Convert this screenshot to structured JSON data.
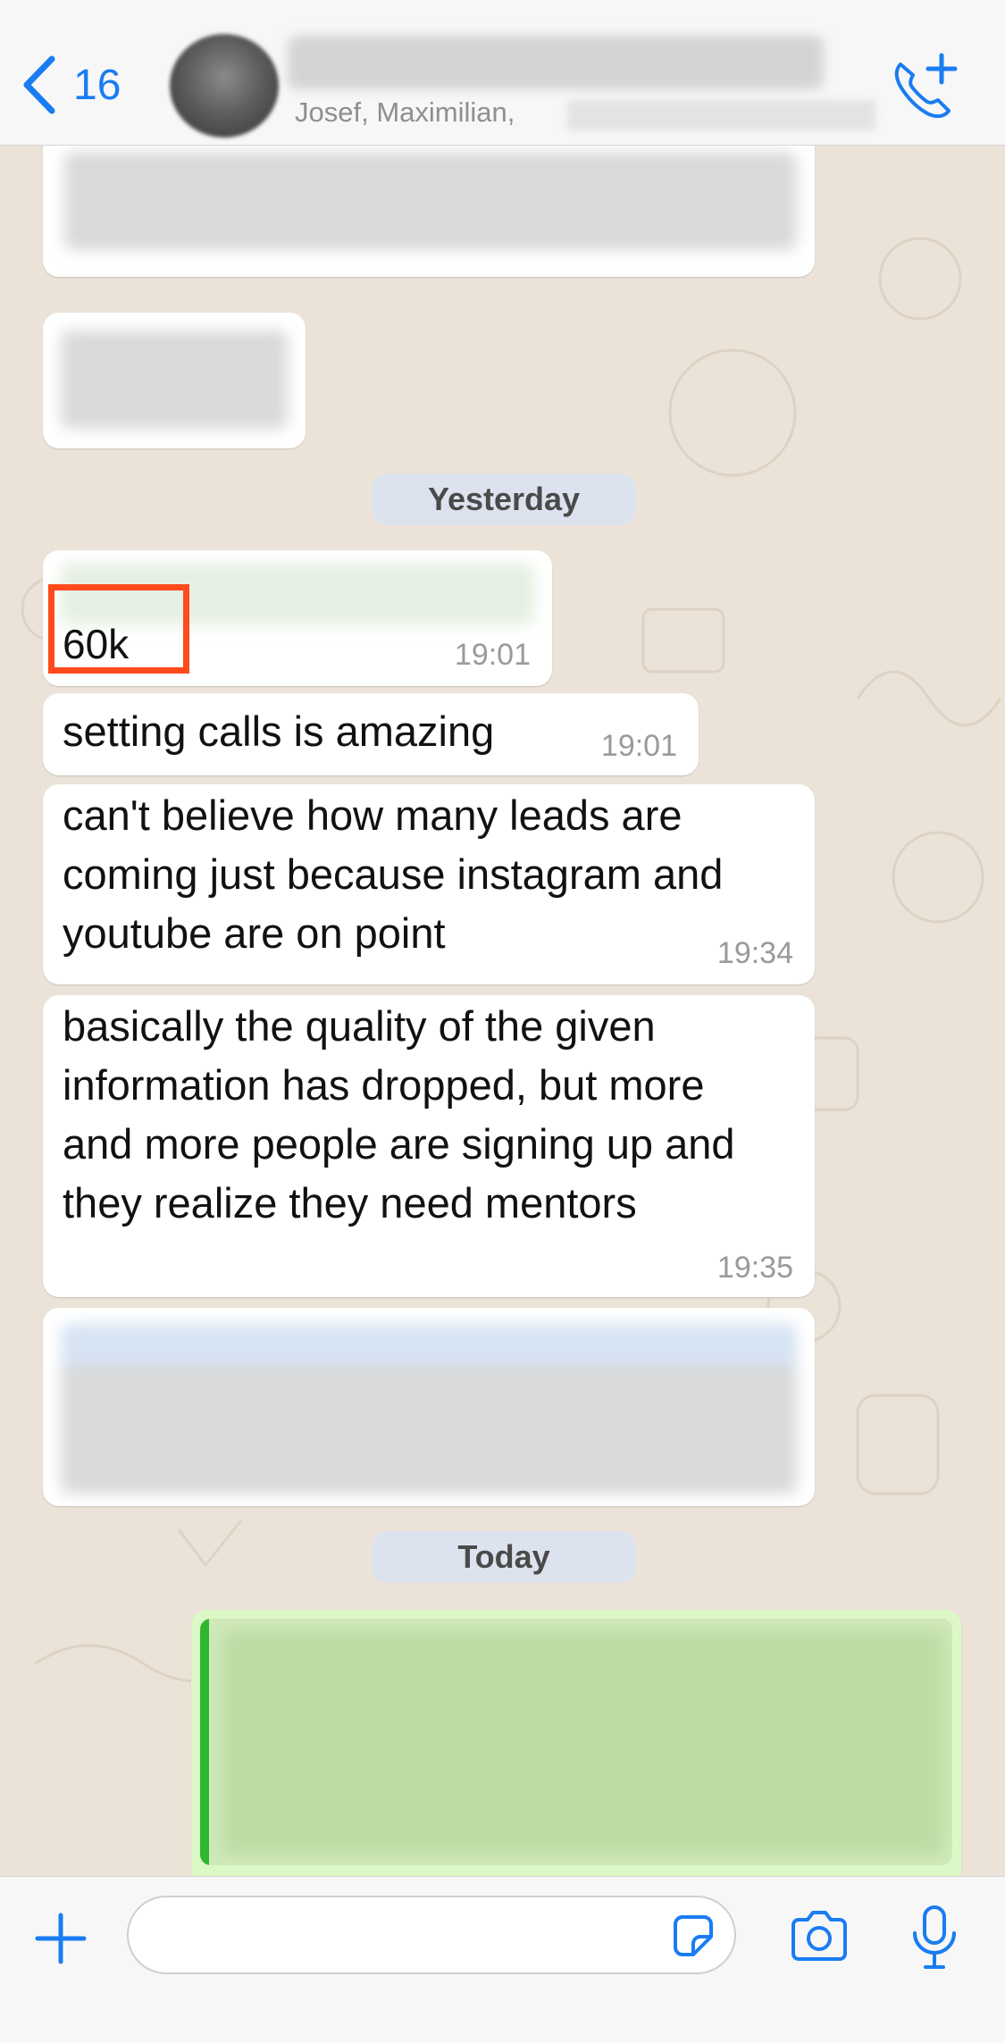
{
  "header": {
    "back_count": "16",
    "subtitle": "Josef, Maximilian,"
  },
  "date_separators": {
    "yesterday": "Yesterday",
    "today": "Today"
  },
  "messages": [
    {
      "text": "60k",
      "time": "19:01"
    },
    {
      "text": "setting calls is amazing",
      "time": "19:01"
    },
    {
      "lines": [
        "can't believe how many leads are",
        "coming just because instagram and",
        "youtube are on point"
      ],
      "time": "19:34"
    },
    {
      "lines": [
        "basically the quality of the given",
        "information has dropped, but more",
        "and more people are signing up and",
        "they realize they need mentors"
      ],
      "time": "19:35"
    }
  ],
  "input": {
    "placeholder": ""
  },
  "colors": {
    "accent": "#1a7cf2",
    "highlight": "#ff4a1c",
    "outgoing_bubble": "#dcf8c6"
  },
  "icons": [
    "chevron-left-icon",
    "phone-plus-icon",
    "plus-icon",
    "sticker-icon",
    "camera-icon",
    "microphone-icon"
  ]
}
